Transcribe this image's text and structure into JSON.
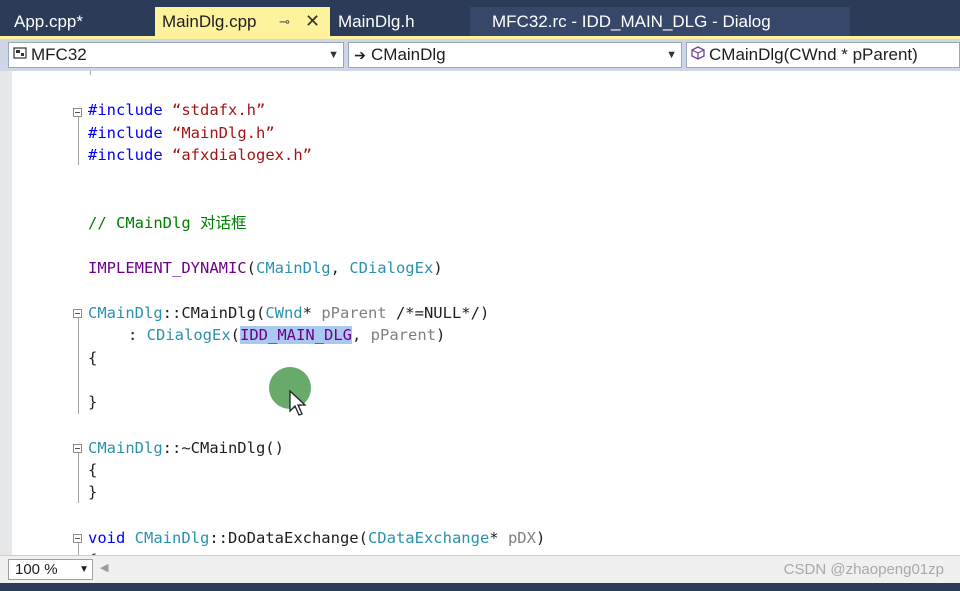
{
  "tabs": [
    {
      "label": "App.cpp*"
    },
    {
      "label": "MainDlg.cpp",
      "pin": "⊸",
      "close": "✕"
    },
    {
      "label": "MainDlg.h"
    },
    {
      "label": "MFC32.rc - IDD_MAIN_DLG - Dialog"
    }
  ],
  "navbar": {
    "project": "MFC32",
    "class_scope": "CMainDlg",
    "member": "CMainDlg(CWnd * pParent)"
  },
  "code": {
    "inc1_kw": "#include",
    "inc1_str": "“stdafx.h”",
    "inc2_kw": "#include",
    "inc2_str": "“MainDlg.h”",
    "inc3_kw": "#include",
    "inc3_str": "“afxdialogex.h”",
    "comment": "// CMainDlg 对话框",
    "impl_macro": "IMPLEMENT_DYNAMIC",
    "impl_open": "(",
    "impl_t1": "CMainDlg",
    "impl_sep": ", ",
    "impl_t2": "CDialogEx",
    "impl_close": ")",
    "ctor_type": "CMainDlg",
    "ctor_name": "::CMainDlg(",
    "ctor_ptype": "CWnd",
    "ctor_star": "* ",
    "ctor_param": "pParent",
    "ctor_default": " /*=NULL*/)",
    "init_colon": ": ",
    "init_base": "CDialogEx",
    "init_open": "(",
    "init_id": "IDD_MAIN_DLG",
    "init_sep": ", ",
    "init_param": "pParent",
    "init_close": ")",
    "brace_open": "{",
    "brace_close": "}",
    "dtor_type": "CMainDlg",
    "dtor_name": "::~CMainDlg()",
    "dde_kw": "void",
    "dde_type": "CMainDlg",
    "dde_name": "::DoDataExchange(",
    "dde_ptype": "CDataExchange",
    "dde_star": "* ",
    "dde_param": "pDX",
    "dde_close": ")"
  },
  "statusbar": {
    "zoom": "100 %",
    "watermark": "CSDN @zhaopeng01zp"
  },
  "colors": {
    "active_tab": "#fff29d",
    "chrome": "#2b3b58",
    "keyword": "#0000ff",
    "string": "#a31515",
    "comment": "#008000",
    "macro": "#6f008a",
    "type": "#2b91af",
    "selection": "#aac8f0"
  }
}
